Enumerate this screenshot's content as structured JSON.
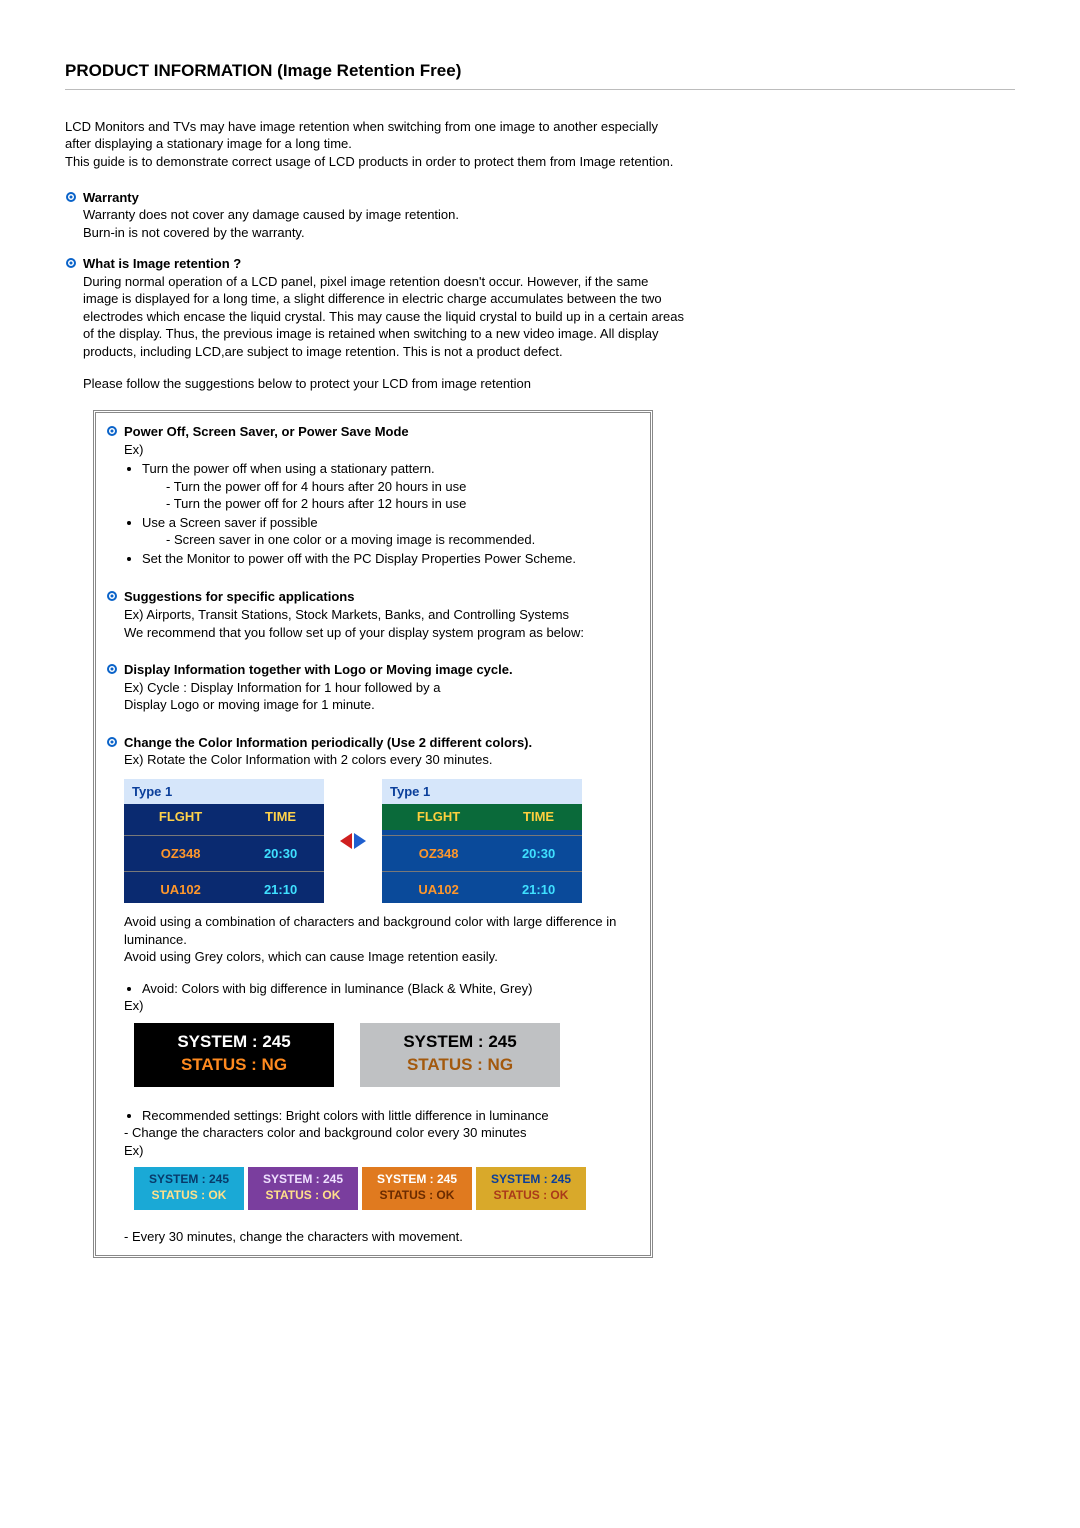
{
  "title": "PRODUCT INFORMATION (Image Retention Free)",
  "intro": {
    "p1": "LCD Monitors and TVs may have image retention when switching from one image to another especially after displaying a stationary image for a long time.",
    "p2": "This guide is to demonstrate correct usage of LCD products in order to protect them from Image retention."
  },
  "warranty": {
    "title": "Warranty",
    "l1": "Warranty does not cover any damage caused by image retention.",
    "l2": "Burn-in is not covered by the warranty."
  },
  "whatis": {
    "title": "What is Image retention ?",
    "body": "During normal operation of a LCD panel, pixel image retention doesn't occur. However, if the same image is displayed for a long time, a slight difference in electric charge accumulates between the two electrodes which encase the liquid crystal. This may cause the liquid crystal to build up in a certain areas of the display. Thus, the previous image is retained when switching to a new video image. All display products, including LCD,are subject to image retention. This is not a product defect."
  },
  "follow": "Please follow the suggestions below to protect your LCD from image retention",
  "powerOff": {
    "title": "Power Off, Screen Saver, or Power Save Mode",
    "ex": "Ex)",
    "li1": "Turn the power off when using a stationary pattern.",
    "li1a": "- Turn the power off for 4 hours after 20 hours in use",
    "li1b": "- Turn the power off for 2 hours after 12 hours in use",
    "li2": "Use a Screen saver if possible",
    "li2a": "- Screen saver in one color or a moving image is recommended.",
    "li3": "Set the Monitor to power off with the PC Display Properties Power Scheme."
  },
  "suggestions": {
    "title": "Suggestions for specific applications",
    "l1": "Ex) Airports, Transit Stations, Stock Markets, Banks, and Controlling Systems",
    "l2": "We recommend that you follow set up of your display system program as below:"
  },
  "displayInfo": {
    "title": "Display Information together with Logo or Moving image cycle.",
    "l1": "Ex) Cycle : Display Information for 1 hour followed by a",
    "l2": "Display Logo or moving image for 1 minute."
  },
  "changeColor": {
    "title": "Change the Color Information periodically (Use 2 different colors).",
    "l1": "Ex) Rotate the Color Information with 2 colors every 30 minutes."
  },
  "flight": {
    "typeLabel": "Type 1",
    "h1": "FLGHT",
    "h2": "TIME",
    "r1c1": "OZ348",
    "r1c2": "20:30",
    "r2c1": "UA102",
    "r2c2": "21:10"
  },
  "afterFlight": {
    "p1": "Avoid using a combination of characters and background color with large difference in luminance.",
    "p2": "Avoid using Grey colors, which can cause Image retention easily."
  },
  "avoid": {
    "li": "Avoid: Colors with big difference in luminance (Black & White, Grey)",
    "ex": "Ex)"
  },
  "status": {
    "line1": "SYSTEM : 245",
    "line2": "STATUS : NG",
    "okLine1": "SYSTEM : 245",
    "okLine2": "STATUS : OK"
  },
  "recommended": {
    "li": "Recommended settings: Bright colors with little difference in luminance",
    "dash": "- Change the characters color and background color every 30 minutes",
    "ex": "Ex)"
  },
  "final": "- Every 30 minutes, change the characters with movement."
}
